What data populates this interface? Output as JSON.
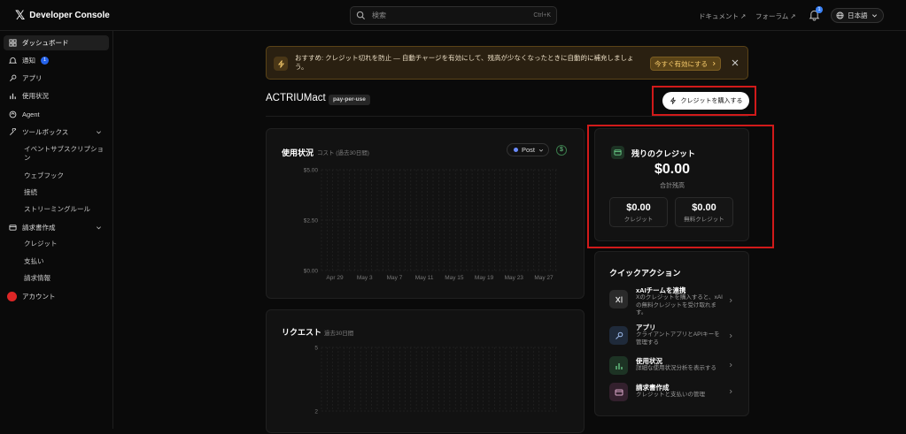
{
  "header": {
    "brand": "Developer Console",
    "search_placeholder": "検索",
    "search_shortcut": "Ctrl+K",
    "links": [
      "ドキュメント ↗",
      "フォーラム ↗"
    ],
    "notification_count": "1",
    "language": "日本語"
  },
  "sidebar": {
    "items": [
      {
        "label": "ダッシュボード",
        "icon": "grid-icon"
      },
      {
        "label": "通知",
        "icon": "bell-icon",
        "badge": "1"
      },
      {
        "label": "アプリ",
        "icon": "key-icon"
      },
      {
        "label": "使用状況",
        "icon": "bar-chart-icon"
      },
      {
        "label": "Agent",
        "icon": "agent-icon"
      },
      {
        "label": "ツールボックス",
        "icon": "tools-icon"
      },
      {
        "label": "請求書作成",
        "icon": "card-icon"
      },
      {
        "label": "アカウント",
        "icon": "avatar"
      }
    ],
    "toolbox_children": [
      "イベントサブスクリプション",
      "ウェブフック",
      "接続",
      "ストリーミングルール"
    ],
    "billing_children": [
      "クレジット",
      "支払い",
      "請求情報"
    ]
  },
  "banner": {
    "text": "おすすめ: クレジット切れを防止 — 自動チャージを有効にして、残高が少なくなったときに自動的に補充しましょう。",
    "action": "今すぐ有効にする"
  },
  "page": {
    "title": "ACTRIUMact",
    "plan": "pay-per-use",
    "buy_button": "クレジットを購入する"
  },
  "usage_card": {
    "title": "使用状況",
    "subtitle": "コスト (過去30日間)",
    "series_select": "Post",
    "dollar_toggle": "$"
  },
  "requests_card": {
    "title": "リクエスト",
    "subtitle": "過去30日間"
  },
  "credits_card": {
    "title": "残りのクレジット",
    "total": "$0.00",
    "total_label": "合計残高",
    "credits_value": "$0.00",
    "credits_label": "クレジット",
    "free_value": "$0.00",
    "free_label": "無料クレジット"
  },
  "quick_actions": {
    "title": "クイックアクション",
    "items": [
      {
        "title": "xAIチームを連携",
        "desc": "Xのクレジットを購入すると、xAIの無料クレジットを受け取れます。",
        "icon": "xai-icon"
      },
      {
        "title": "アプリ",
        "desc": "クライアントアプリとAPIキーを管理する",
        "icon": "key-icon"
      },
      {
        "title": "使用状況",
        "desc": "詳細な使用状況分析を表示する",
        "icon": "bar-chart-icon"
      },
      {
        "title": "請求書作成",
        "desc": "クレジットと支払いの管理",
        "icon": "card-icon"
      }
    ]
  },
  "colors": {
    "accent": "#3b82f6",
    "warning": "#fbcf6e",
    "highlight": "#d11a1a"
  },
  "chart_data": [
    {
      "type": "line",
      "title": "使用状況",
      "subtitle": "コスト (過去30日間)",
      "x": [
        "Apr 29",
        "May 3",
        "May 7",
        "May 11",
        "May 15",
        "May 19",
        "May 23",
        "May 27"
      ],
      "y_ticks": [
        "$5.00",
        "$2.50",
        "$0.00"
      ],
      "ylim": [
        0,
        5
      ],
      "series": [
        {
          "name": "Post",
          "values": []
        }
      ],
      "grid": true
    },
    {
      "type": "line",
      "title": "リクエスト",
      "subtitle": "過去30日間",
      "y_ticks": [
        "5",
        "2"
      ],
      "series": [],
      "grid": true
    }
  ]
}
